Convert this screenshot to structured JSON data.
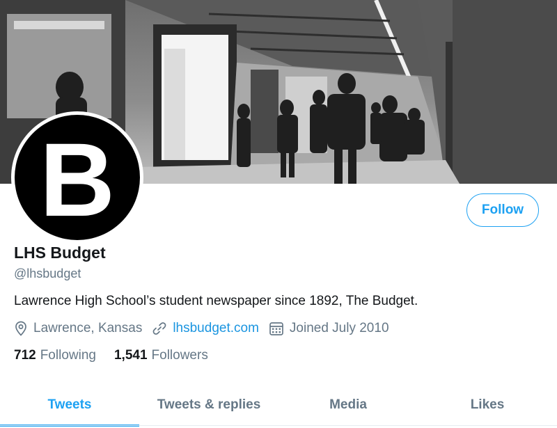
{
  "profile": {
    "avatar_letter": "B",
    "display_name": "LHS Budget",
    "handle": "@lhsbudget",
    "bio": "Lawrence High School’s student newspaper since 1892, The Budget.",
    "location": "Lawrence, Kansas",
    "website": "lhsbudget.com",
    "joined": "Joined July 2010"
  },
  "actions": {
    "follow_label": "Follow"
  },
  "stats": {
    "following_count": "712",
    "following_label": "Following",
    "followers_count": "1,541",
    "followers_label": "Followers"
  },
  "tabs": [
    {
      "label": "Tweets",
      "active": true
    },
    {
      "label": "Tweets & replies",
      "active": false
    },
    {
      "label": "Media",
      "active": false
    },
    {
      "label": "Likes",
      "active": false
    }
  ],
  "icons": {
    "location": "location-pin-icon",
    "website": "link-icon",
    "joined": "calendar-icon"
  },
  "colors": {
    "accent": "#1da1f2",
    "link": "#1b95e0",
    "secondary_text": "#657786",
    "primary_text": "#14171a"
  }
}
